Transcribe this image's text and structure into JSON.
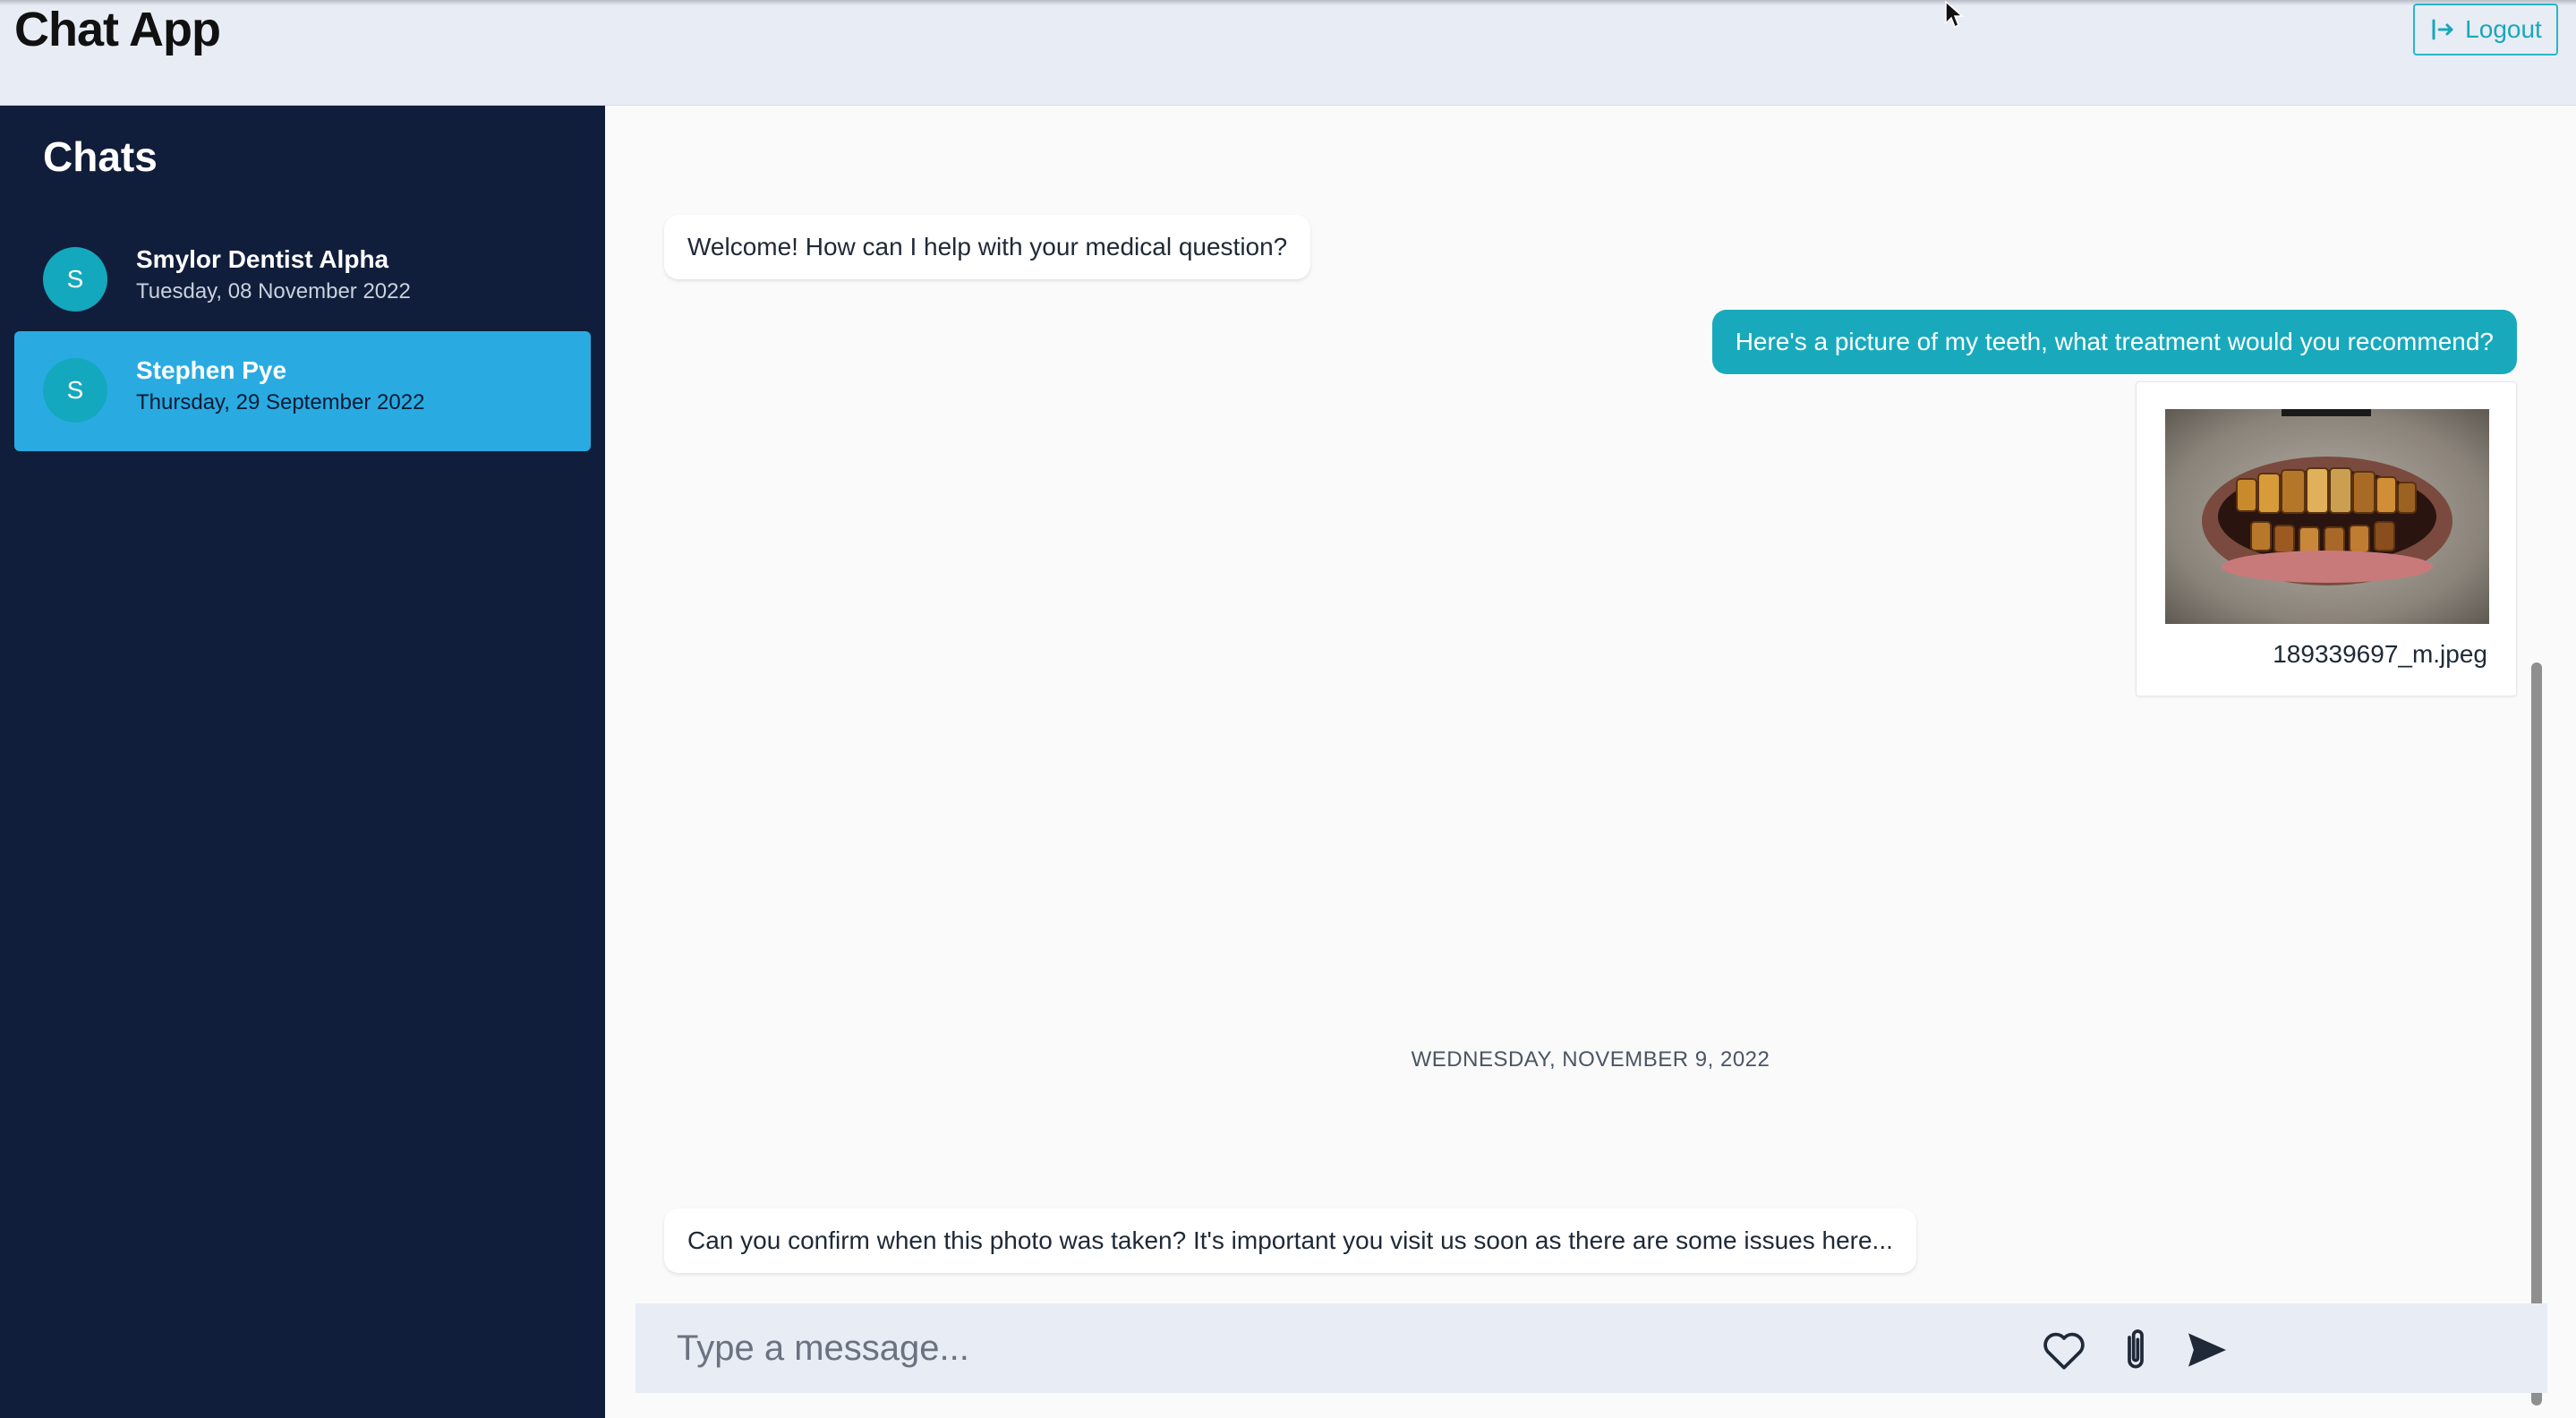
{
  "header": {
    "title": "Chat App",
    "logout_label": "Logout"
  },
  "sidebar": {
    "title": "Chats",
    "chats": [
      {
        "avatar": "S",
        "name": "Smylor Dentist Alpha",
        "date": "Tuesday, 08 November 2022",
        "active": false
      },
      {
        "avatar": "S",
        "name": "Stephen Pye",
        "date": "Thursday, 29 September 2022",
        "active": true
      }
    ]
  },
  "messages": {
    "welcome": "Welcome! How can I help with your medical question?",
    "user_question": "Here's a picture of my teeth, what treatment would you recommend?",
    "attachment_filename": "189339697_m.jpeg",
    "date_divider": "WEDNESDAY, NOVEMBER 9, 2022",
    "dentist_reply": "Can you confirm when this photo was taken? It's important you visit us soon as there are some issues here..."
  },
  "composer": {
    "placeholder": "Type a message..."
  },
  "icons": {
    "logout": "logout-icon",
    "like": "heart-icon",
    "attach": "paperclip-icon",
    "send": "send-icon"
  },
  "colors": {
    "accent": "#18aabc",
    "sidebar_bg": "#111e3b",
    "active_chat": "#29abe2",
    "header_bg": "#e8ecf5"
  }
}
